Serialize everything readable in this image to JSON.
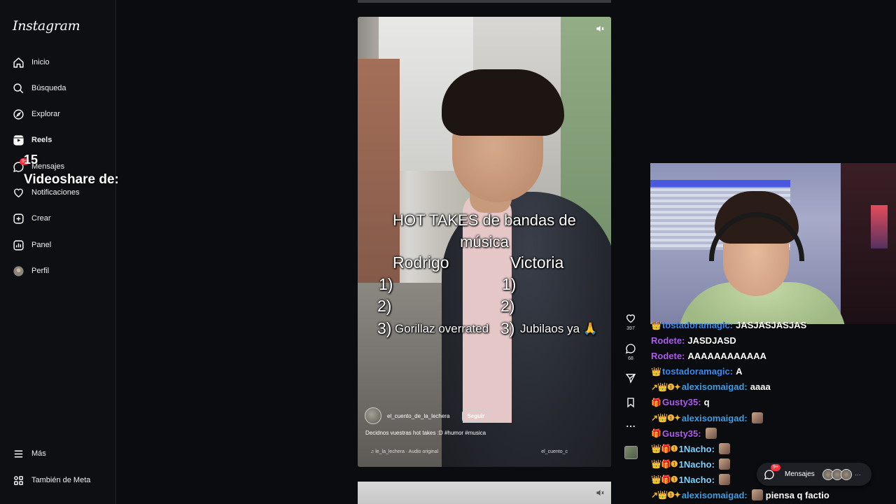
{
  "app": {
    "logo": "Instagram"
  },
  "sidebar": {
    "items": [
      {
        "id": "inicio",
        "label": "Inicio",
        "icon": "home-icon"
      },
      {
        "id": "busqueda",
        "label": "Búsqueda",
        "icon": "search-icon"
      },
      {
        "id": "explorar",
        "label": "Explorar",
        "icon": "compass-icon"
      },
      {
        "id": "reels",
        "label": "Reels",
        "icon": "reels-icon",
        "active": true
      },
      {
        "id": "mensajes",
        "label": "Mensajes",
        "icon": "messenger-icon",
        "badge": "9+"
      },
      {
        "id": "notificaciones",
        "label": "Notificaciones",
        "icon": "heart-icon"
      },
      {
        "id": "crear",
        "label": "Crear",
        "icon": "plus-square-icon"
      },
      {
        "id": "panel",
        "label": "Panel",
        "icon": "chart-icon"
      },
      {
        "id": "perfil",
        "label": "Perfil",
        "icon": "avatar-icon"
      }
    ],
    "more": "Más",
    "meta": "También de Meta"
  },
  "overlay": {
    "count": "15",
    "share_text": "Videoshare de:"
  },
  "reel": {
    "title_line1": "HOT TAKES de bandas de",
    "title_line2": "música",
    "left_header": "Rodrigo",
    "right_header": "Victoria",
    "left_items": [
      "1)",
      "2)",
      "3)"
    ],
    "right_items": [
      "1)",
      "2)",
      "3)"
    ],
    "left_take3": "Gorillaz overrated",
    "right_take3": "Jubilaos ya 🙏",
    "author": "el_cuento_de_la_lechera",
    "follow": "Seguir",
    "caption": "Decidnos vuestras hot takes :D #humor #musica",
    "audio": "♫ le_la_lechera · Audio original",
    "audio_right": "el_cuento_c"
  },
  "actions": {
    "likes": "397",
    "comments": "68"
  },
  "chat": [
    {
      "badges": "👑",
      "user": "tostadoramagic:",
      "user_color": "#3b8ded",
      "text": "JASJASJASJAS"
    },
    {
      "badges": "",
      "user": "Rodete:",
      "user_color": "#b05cf0",
      "text": "JASDJASD"
    },
    {
      "badges": "",
      "user": "Rodete:",
      "user_color": "#b05cf0",
      "text": "AAAAAAAAAAAA"
    },
    {
      "badges": "👑",
      "user": "tostadoramagic:",
      "user_color": "#3b8ded",
      "text": "A"
    },
    {
      "badges": "↗👑❶✦",
      "user": "alexisomaigad:",
      "user_color": "#3ea0e6",
      "text": "aaaa"
    },
    {
      "badges": "🎁",
      "user": "Gusty35:",
      "user_color": "#b05cf0",
      "text": "q"
    },
    {
      "badges": "↗👑❶✦",
      "user": "alexisomaigad:",
      "user_color": "#3ea0e6",
      "text": "",
      "emote": true
    },
    {
      "badges": "🎁",
      "user": "Gusty35:",
      "user_color": "#b05cf0",
      "text": "",
      "emote": true
    },
    {
      "badges": "👑🎁❶",
      "user": "1Nacho:",
      "user_color": "#7fd3ff",
      "text": "",
      "emote": true
    },
    {
      "badges": "👑🎁❶",
      "user": "1Nacho:",
      "user_color": "#7fd3ff",
      "text": "",
      "emote": true
    },
    {
      "badges": "👑🎁❶",
      "user": "1Nacho:",
      "user_color": "#7fd3ff",
      "text": "",
      "emote": true
    },
    {
      "badges": "↗👑❶✦",
      "user": "alexisomaigad:",
      "user_color": "#3ea0e6",
      "text": "piensa q factio",
      "emote": true
    }
  ],
  "messages_pill": {
    "label": "Mensajes",
    "badge": "9+",
    "more": "···"
  }
}
